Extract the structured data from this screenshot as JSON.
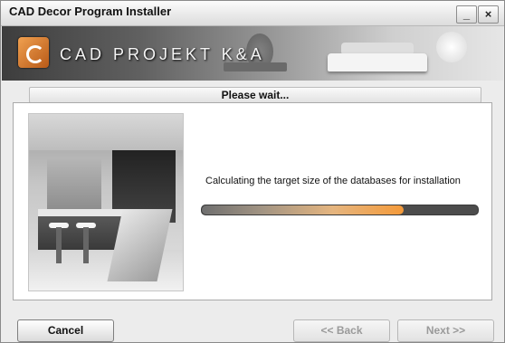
{
  "window": {
    "title": "CAD Decor Program Installer",
    "minimize_label": "_",
    "close_label": "×"
  },
  "banner": {
    "brand": "CAD PROJEKT K&A"
  },
  "status": {
    "heading": "Please wait..."
  },
  "main": {
    "message": "Calculating the target size of the databases for installation",
    "progress_percent": 73
  },
  "buttons": {
    "cancel": "Cancel",
    "back": "<< Back",
    "next": "Next >>"
  },
  "colors": {
    "accent_orange": "#f49a3a",
    "progress_track": "#4c4c4c"
  },
  "icons": {
    "logo": "cad-projekt-logo-icon"
  }
}
